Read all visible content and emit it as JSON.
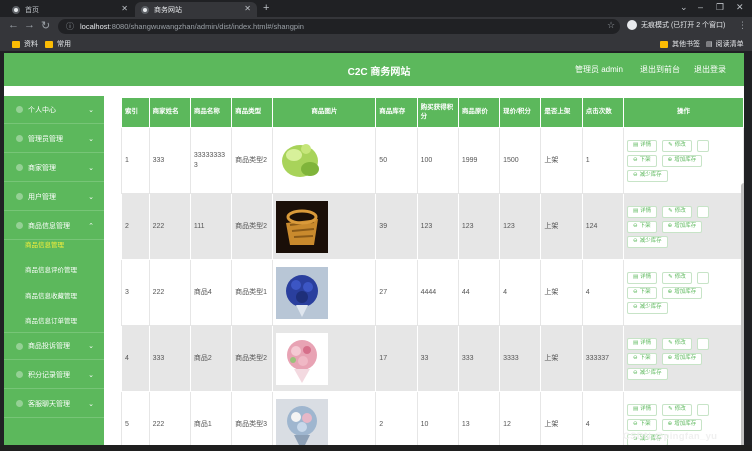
{
  "browser": {
    "tabs": [
      {
        "title": "首页"
      },
      {
        "title": "商务网站"
      }
    ],
    "new_tab_label": "+",
    "url_host": "localhost",
    "url_rest": ":8080/shangwuwangzhan/admin/dist/index.html#/shangpin",
    "incognito_label": "无痕模式 (已打开 2 个窗口)",
    "bookmarks": [
      {
        "label": "资料"
      },
      {
        "label": "常用"
      }
    ],
    "bookmarks_right": [
      {
        "label": "其他书签"
      },
      {
        "label": "阅读清单"
      }
    ]
  },
  "header": {
    "title": "C2C 商务网站",
    "admin_label": "管理员 admin",
    "back_label": "退出到前台",
    "logout_label": "退出登录"
  },
  "sidebar": {
    "items": [
      {
        "label": "个人中心",
        "chev": "⌄"
      },
      {
        "label": "管理员管理",
        "chev": "⌄"
      },
      {
        "label": "商家管理",
        "chev": "⌄"
      },
      {
        "label": "用户管理",
        "chev": "⌄"
      },
      {
        "label": "商品信息管理",
        "chev": "⌃"
      },
      {
        "label": "商品投诉管理",
        "chev": "⌄"
      },
      {
        "label": "积分记录管理",
        "chev": "⌄"
      },
      {
        "label": "客服聊天管理",
        "chev": "⌄"
      }
    ],
    "subitems": [
      {
        "label": "商品信息管理",
        "active": true
      },
      {
        "label": "商品信息评价管理",
        "active": false
      },
      {
        "label": "商品信息收藏管理",
        "active": false
      },
      {
        "label": "商品信息订单管理",
        "active": false
      }
    ]
  },
  "table": {
    "columns": [
      "索引",
      "商家姓名",
      "商品名称",
      "商品类型",
      "商品图片",
      "商品库存",
      "购买获得积分",
      "商品原价",
      "现价/积分",
      "是否上架",
      "点击次数",
      "操作"
    ],
    "rows": [
      {
        "index": "1",
        "merchant": "333",
        "name": "333333333",
        "type": "商品类型2",
        "image": "green-plush",
        "stock": "50",
        "points": "100",
        "orig": "1999",
        "price": "1500",
        "onsale": "上架",
        "clicks": "1",
        "ops": [
          "详情",
          "修改",
          "",
          "下架",
          "增加库存",
          "减少库存"
        ]
      },
      {
        "index": "2",
        "merchant": "222",
        "name": "111",
        "type": "商品类型2",
        "image": "basket",
        "stock": "39",
        "points": "123",
        "orig": "123",
        "price": "123",
        "onsale": "上架",
        "clicks": "124",
        "ops": [
          "详情",
          "修改",
          "",
          "下架",
          "增加库存",
          "减少库存"
        ]
      },
      {
        "index": "3",
        "merchant": "222",
        "name": "商品4",
        "type": "商品类型1",
        "image": "blue-bouquet",
        "stock": "27",
        "points": "4444",
        "orig": "44",
        "price": "4",
        "onsale": "上架",
        "clicks": "4",
        "ops": [
          "详情",
          "修改",
          "",
          "下架",
          "增加库存",
          "减少库存"
        ]
      },
      {
        "index": "4",
        "merchant": "333",
        "name": "商品2",
        "type": "商品类型2",
        "image": "pink-bouquet",
        "stock": "17",
        "points": "33",
        "orig": "333",
        "price": "3333",
        "onsale": "上架",
        "clicks": "333337",
        "ops": [
          "详情",
          "修改",
          "",
          "下架",
          "增加库存",
          "减少库存"
        ]
      },
      {
        "index": "5",
        "merchant": "222",
        "name": "商品1",
        "type": "商品类型3",
        "image": "mixed-bouquet",
        "stock": "2",
        "points": "10",
        "orig": "13",
        "price": "12",
        "onsale": "上架",
        "clicks": "4",
        "ops": [
          "详情",
          "修改",
          "",
          "下架",
          "增加库存",
          "减少库存"
        ]
      }
    ]
  },
  "watermark": "CSDN @pingfan_yu",
  "colors": {
    "primary": "#5cb85c",
    "active_sub": "#f8f03a"
  }
}
